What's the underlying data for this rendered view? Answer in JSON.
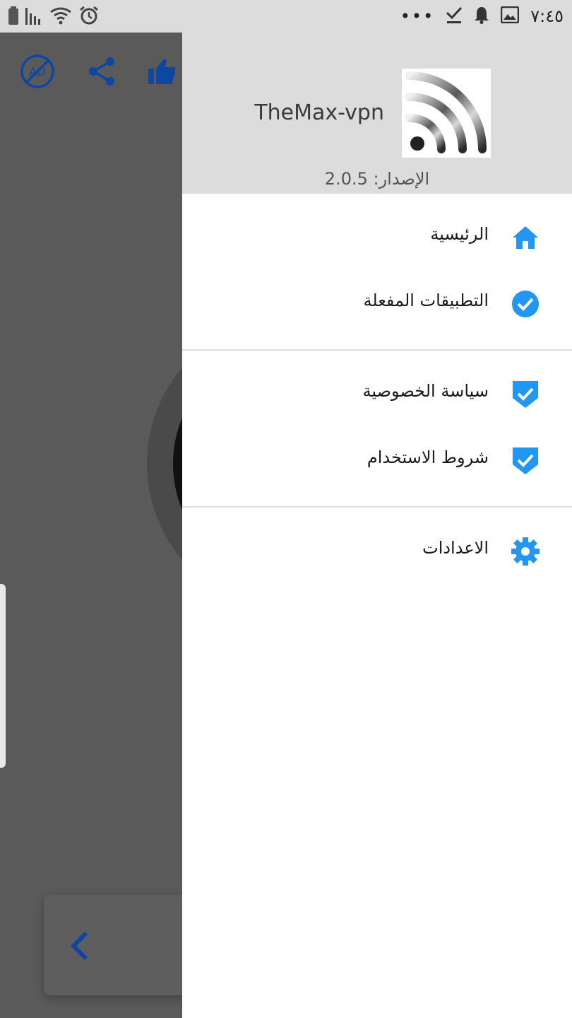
{
  "status_bar": {
    "time": "٧:٤٥",
    "more_icon": "more-dots",
    "right_icons": [
      "check-download-icon",
      "bell-icon",
      "image-icon"
    ],
    "left_icons": [
      "battery-icon",
      "signal-icon",
      "wifi-icon",
      "alarm-icon"
    ]
  },
  "background_app": {
    "toolbar_icons": [
      "no-ads-icon",
      "share-icon",
      "thumbs-up-icon"
    ],
    "ad_icon_text": "AD",
    "back_icon": "chevron-left-icon"
  },
  "drawer": {
    "header": {
      "app_name": "TheMax-vpn",
      "version": "الإصدار: 2.0.5"
    },
    "items": [
      {
        "label": "الرئيسية",
        "icon": "home-icon"
      },
      {
        "label": "التطبيقات المفعلة",
        "icon": "check-circle-icon"
      },
      {
        "label": "سياسة الخصوصية",
        "icon": "shield-check-icon"
      },
      {
        "label": "شروط الاستخدام",
        "icon": "shield-check-icon"
      },
      {
        "label": "الاعدادات",
        "icon": "gear-icon"
      }
    ]
  },
  "colors": {
    "accent": "#2196F3",
    "header_bg": "#dcdcdc",
    "scrim": "#5a5a5a"
  }
}
